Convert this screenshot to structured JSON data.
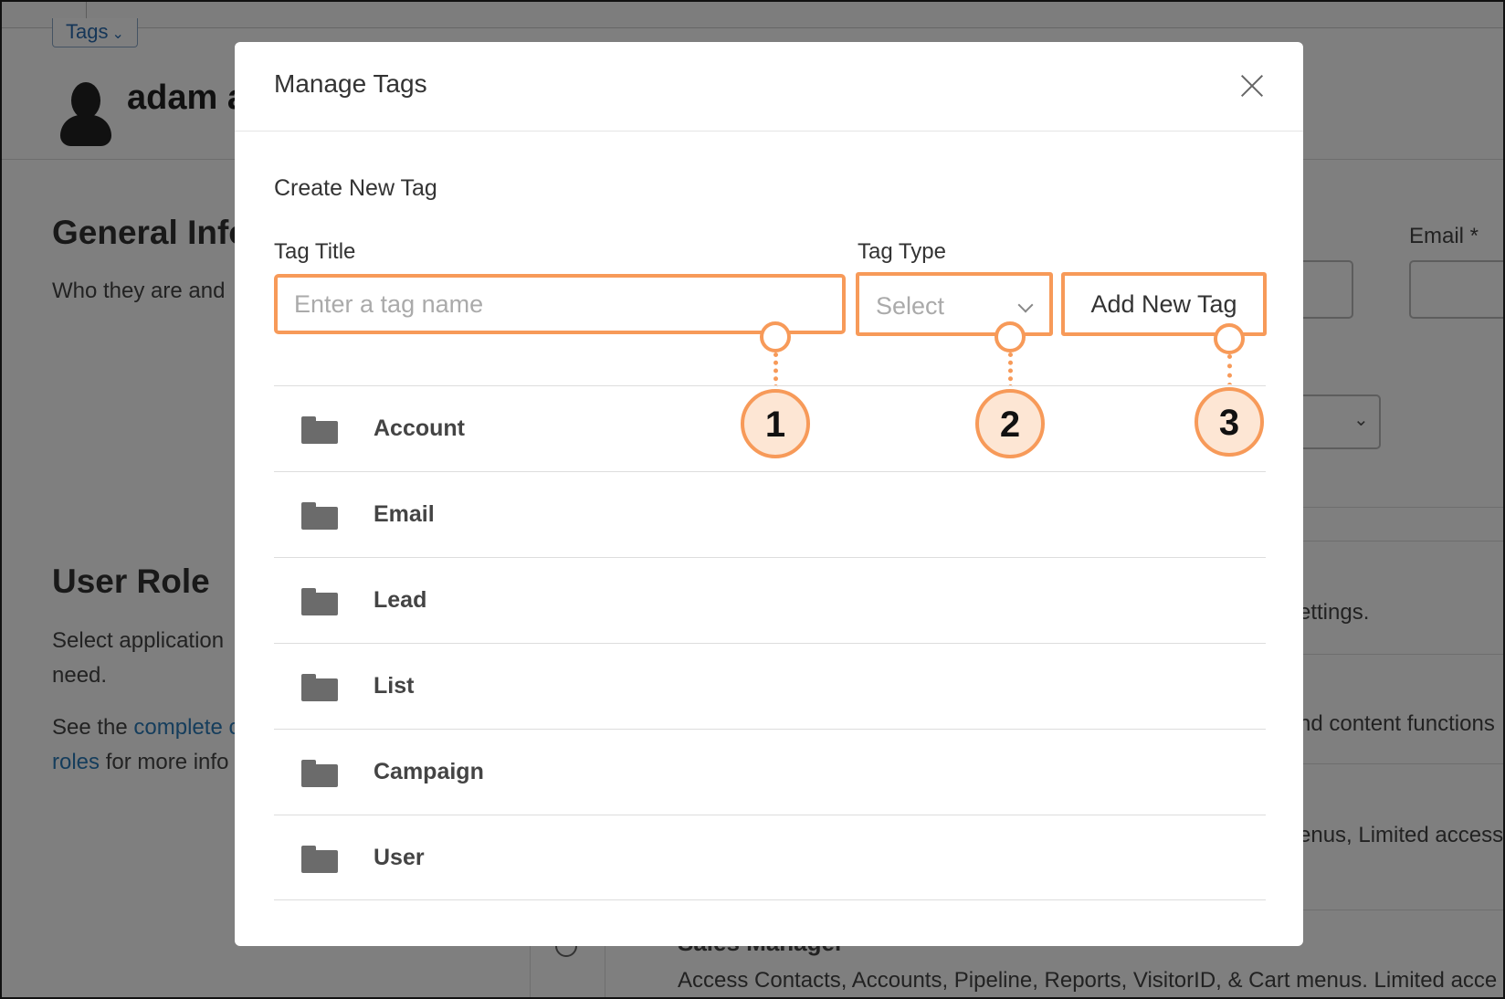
{
  "background": {
    "tags_button": "Tags",
    "profile_name": "adam a",
    "general_info_heading": "General Info",
    "general_info_sub": "Who they are and",
    "email_label": "Email *",
    "user_role_heading": "User Role",
    "user_role_line1": "Select application",
    "user_role_line2": "need.",
    "see_the": "See the ",
    "complete_link": "complete c",
    "roles_link": "roles",
    "more_info": " for more info",
    "right_text_1": "ettings.",
    "right_text_2": "nd content functions",
    "right_text_3": "enus, Limited access",
    "bottom_role_title": "Sales Manager",
    "bottom_role_desc": "Access Contacts, Accounts, Pipeline, Reports, VisitorID, & Cart menus. Limited acce"
  },
  "modal": {
    "title": "Manage Tags",
    "create_section_title": "Create New Tag",
    "tag_title_label": "Tag Title",
    "tag_title_placeholder": "Enter a tag name",
    "tag_type_label": "Tag Type",
    "tag_type_selected": "Select",
    "add_button_label": "Add New Tag",
    "tags": [
      "Account",
      "Email",
      "Lead",
      "List",
      "Campaign",
      "User"
    ]
  },
  "callouts": [
    "1",
    "2",
    "3"
  ],
  "colors": {
    "accent_orange": "#f79a59",
    "badge_fill": "#fde6d4",
    "link_blue": "#2b7bb9",
    "folder_gray": "#6b6b6b"
  }
}
